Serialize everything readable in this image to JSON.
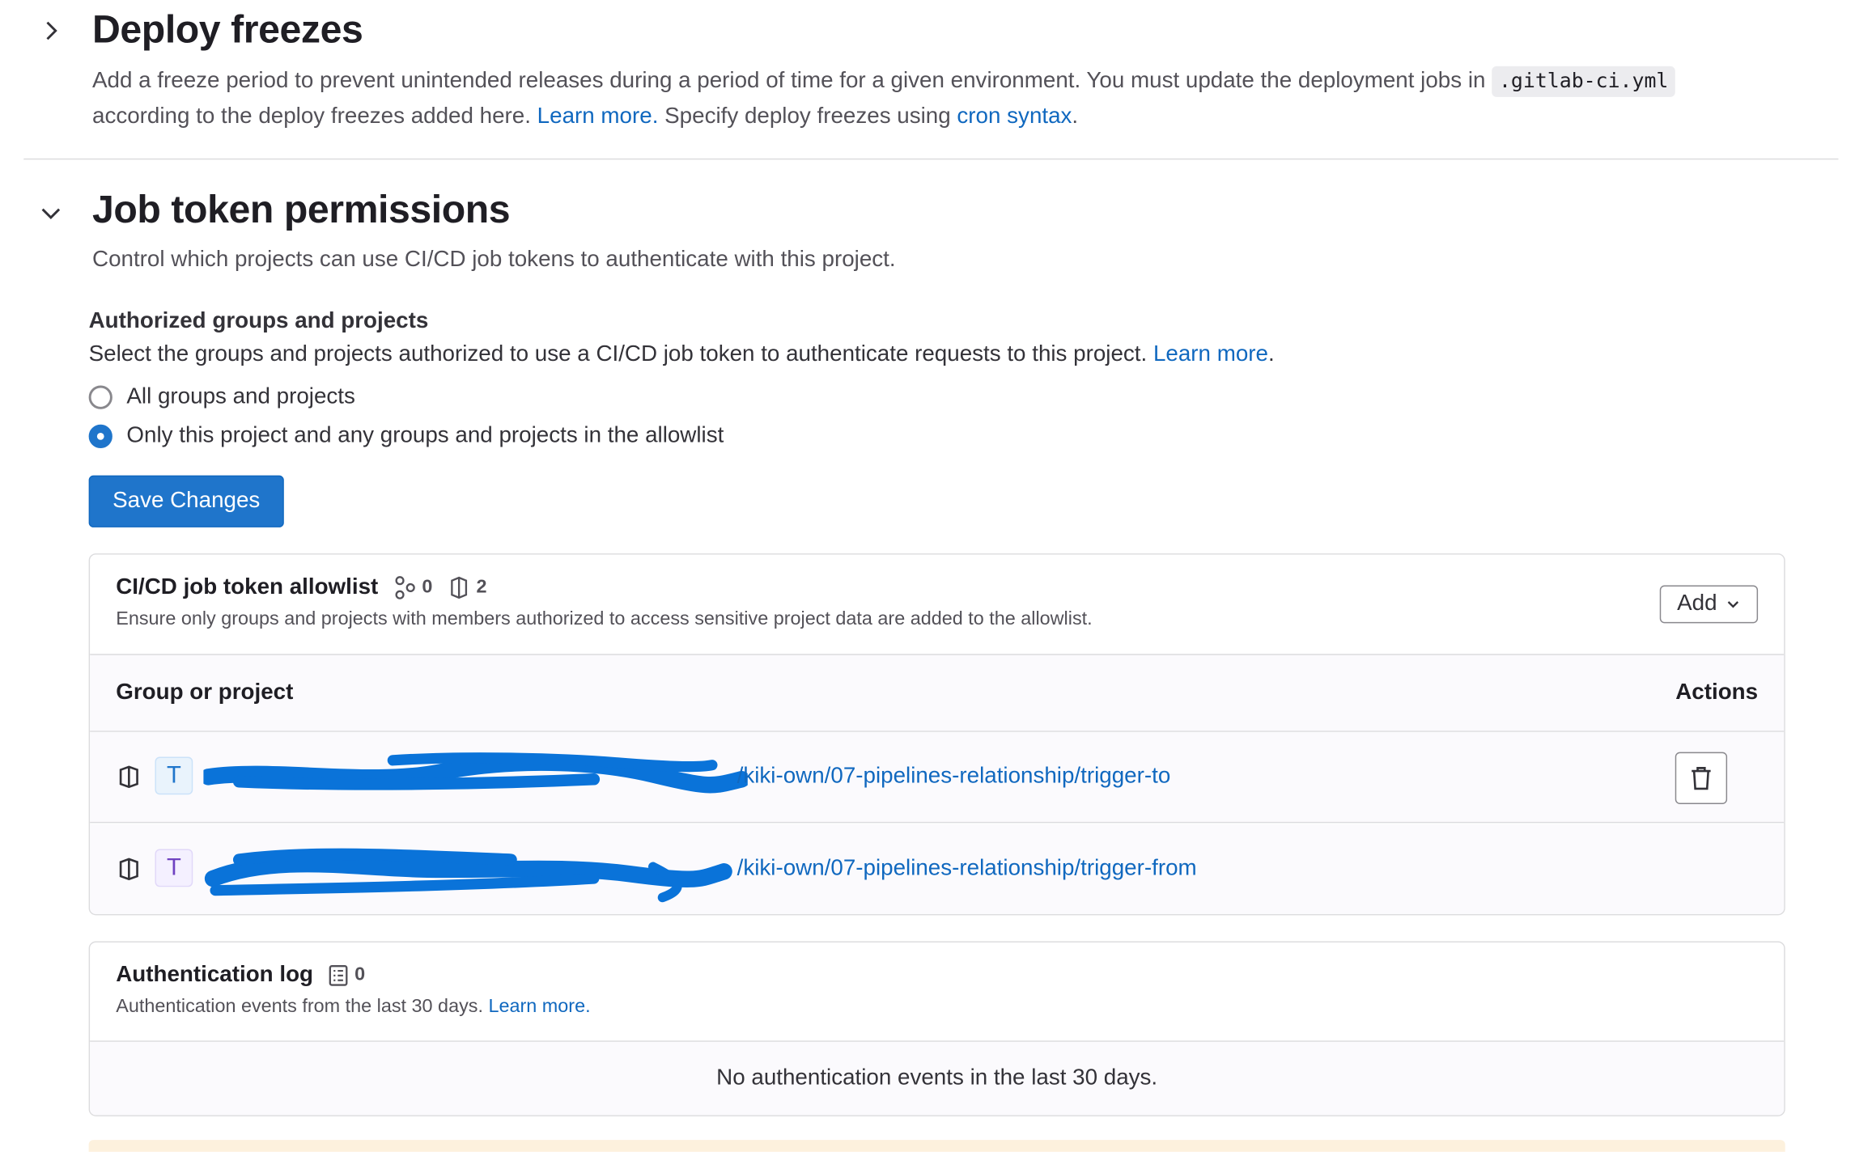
{
  "deploy_freezes": {
    "title": "Deploy freezes",
    "desc_part1": "Add a freeze period to prevent unintended releases during a period of time for a given environment. You must update the deployment jobs in",
    "code": ".gitlab-ci.yml",
    "desc_part2": "according to the deploy freezes added here.",
    "learn_more": "Learn more.",
    "desc_part3": "Specify deploy freezes using",
    "cron_link": "cron syntax",
    "desc_end": "."
  },
  "job_token": {
    "title": "Job token permissions",
    "desc": "Control which projects can use CI/CD job tokens to authenticate with this project.",
    "auth_label": "Authorized groups and projects",
    "auth_help": "Select the groups and projects authorized to use a CI/CD job token to authenticate requests to this project.",
    "auth_learn_more": "Learn more",
    "auth_help_end": ".",
    "radio_all": "All groups and projects",
    "radio_only": "Only this project and any groups and projects in the allowlist",
    "selected": "only",
    "save_button": "Save Changes"
  },
  "allowlist": {
    "title": "CI/CD job token allowlist",
    "group_count": "0",
    "project_count": "2",
    "subtitle": "Ensure only groups and projects with members authorized to access sensitive project data are added to the allowlist.",
    "add_button": "Add",
    "col_group": "Group or project",
    "col_actions": "Actions",
    "rows": [
      {
        "avatar": "T",
        "path": "/kiki-own/07-pipelines-relationship/trigger-to",
        "avatar_bg": "#e9f3fc",
        "avatar_fg": "#1f75cb"
      },
      {
        "avatar": "T",
        "path": "/kiki-own/07-pipelines-relationship/trigger-from",
        "avatar_bg": "#f4f0ff",
        "avatar_fg": "#6f42c1"
      }
    ]
  },
  "auth_log": {
    "title": "Authentication log",
    "count": "0",
    "subtitle": "Authentication events from the last 30 days.",
    "learn_more": "Learn more.",
    "empty": "No authentication events in the last 30 days."
  },
  "colors": {
    "primary": "#1f75cb",
    "link": "#1068bf",
    "redaction": "#0a73d9"
  }
}
